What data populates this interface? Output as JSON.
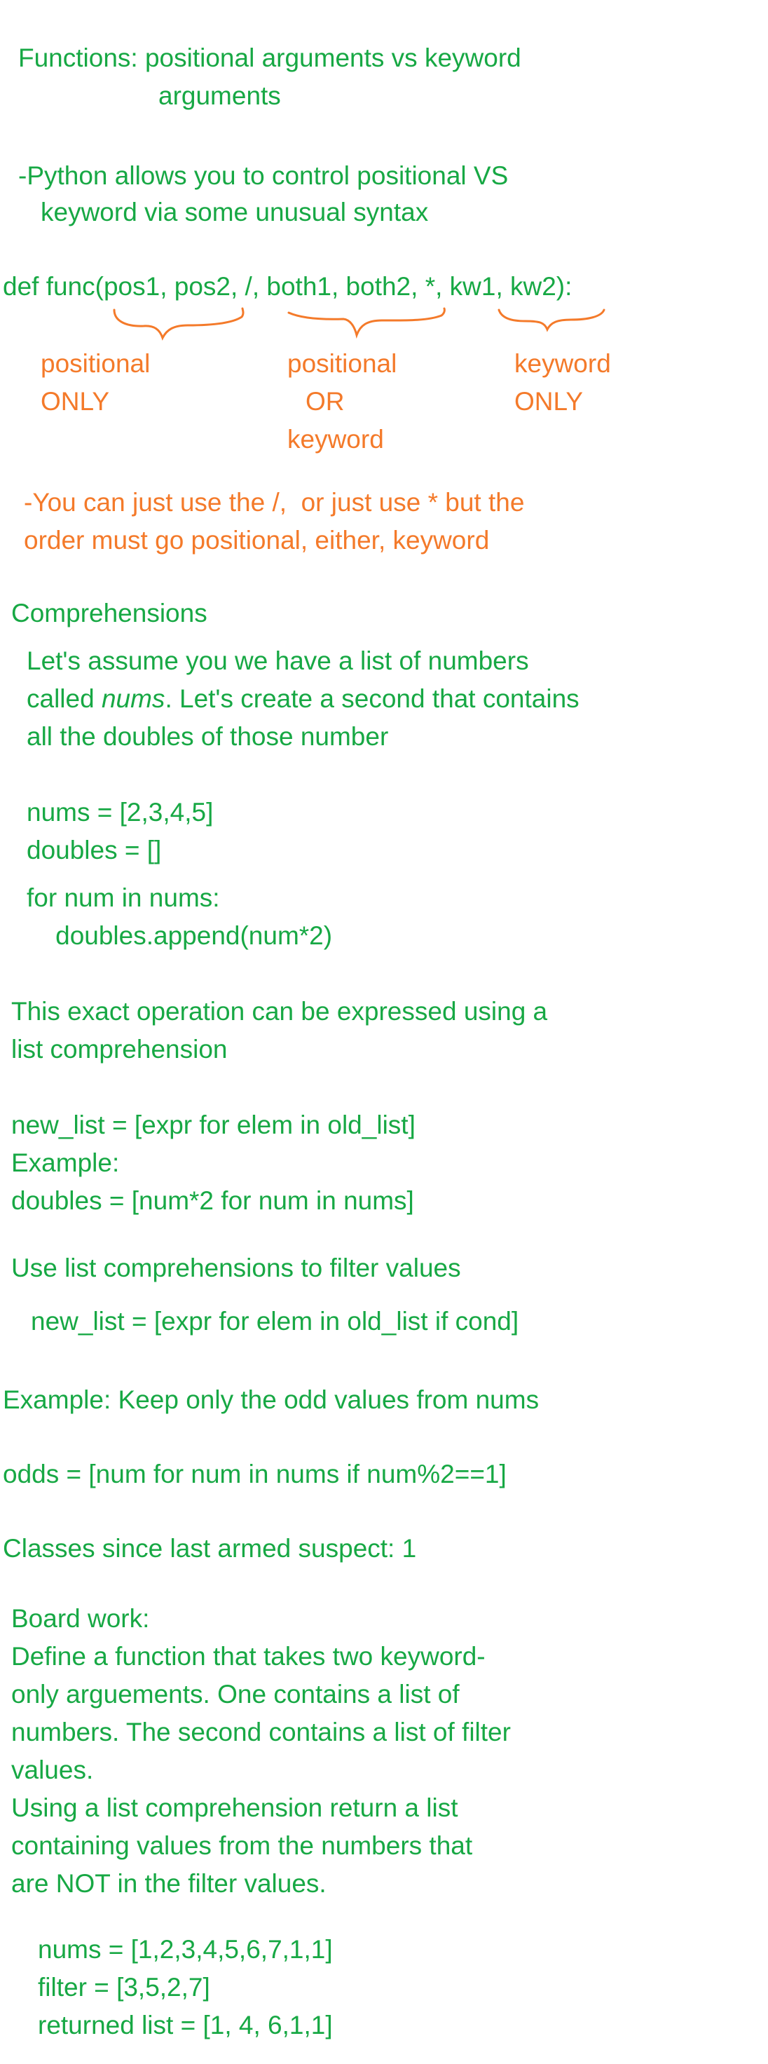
{
  "header": {
    "title_line1": "Functions: positional arguments vs keyword",
    "title_line2": "arguments"
  },
  "intro": {
    "line1": "-Python allows you to control positional VS",
    "line2": "keyword via some unusual syntax"
  },
  "signature": {
    "code": "def func(pos1, pos2, /, both1, both2, *, kw1, kw2):"
  },
  "annotations": {
    "positional_only": [
      "positional",
      "ONLY"
    ],
    "positional_or_keyword": [
      "positional",
      "OR",
      "keyword"
    ],
    "keyword_only": [
      "keyword",
      "ONLY"
    ],
    "note_line1": "-You can just use the /,  or just use * but the",
    "note_line2": "order must go positional, either, keyword"
  },
  "comprehensions": {
    "heading": "Comprehensions",
    "desc_line1": "Let's assume you we have a list of numbers",
    "desc_line2_before": "called ",
    "desc_line2_italic": "nums",
    "desc_line2_after": ". Let's create a second that contains",
    "desc_line3": "all the doubles of those number",
    "code": [
      "nums = [2,3,4,5]",
      "doubles = []",
      "for num in nums:",
      "    doubles.append(num*2)"
    ],
    "expr_line1": "This exact operation can be expressed using a",
    "expr_line2": "list comprehension",
    "syntax": "new_list = [expr for elem in old_list]",
    "example_label": "Example:",
    "example_code": "doubles = [num*2 for num in nums]",
    "filter_heading": "Use list comprehensions to filter values",
    "filter_syntax": "new_list = [expr for elem in old_list if cond]",
    "filter_example_label": "Example: Keep only the odd values from nums",
    "filter_example_code": "odds = [num for num in nums if num%2==1]"
  },
  "counter": {
    "text": "Classes since last armed suspect: 1"
  },
  "board_work": {
    "heading": "Board work:",
    "lines": [
      "Define a function that takes two keyword-",
      "only arguements. One contains a list of",
      "numbers. The second contains a list of filter",
      "values.",
      "Using a list comprehension return a list",
      "containing values from the numbers that",
      "are NOT in the filter values."
    ],
    "code": [
      "nums = [1,2,3,4,5,6,7,1,1]",
      "filter = [3,5,2,7]",
      "returned list = [1, 4, 6,1,1]"
    ]
  },
  "colors": {
    "green_text": "#17a844",
    "orange_ink": "#f47a2a",
    "background": "#ffffff"
  }
}
